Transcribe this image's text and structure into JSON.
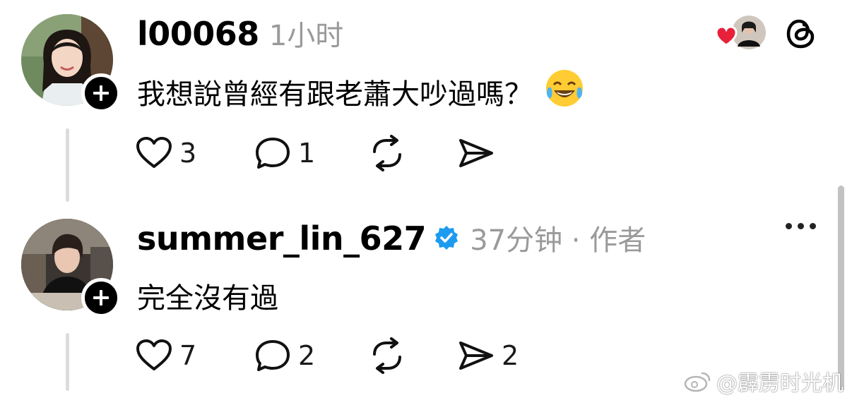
{
  "posts": [
    {
      "username": "l00068",
      "meta": "1小时",
      "text": "我想說曾經有跟老蕭大吵過嗎？",
      "emoji": "face-with-tears-of-joy",
      "likes": "3",
      "replies": "1",
      "reposts": "",
      "shares": ""
    },
    {
      "username": "summer_lin_627",
      "verified": true,
      "meta": "37分钟 · 作者",
      "text": "完全沒有過",
      "likes": "7",
      "replies": "2",
      "reposts": "",
      "shares": "2"
    }
  ],
  "watermark": "@霹雳时光机",
  "colors": {
    "verified": "#1d9bf0",
    "meta_gray": "#9a9a9a",
    "thread_line": "#dcdcdc",
    "heart_red": "#e8203a"
  },
  "icons": {
    "like": "heart-outline-icon",
    "reply": "speech-bubble-icon",
    "repost": "repost-arrows-icon",
    "share": "paper-plane-icon",
    "app": "threads-logo-icon"
  }
}
